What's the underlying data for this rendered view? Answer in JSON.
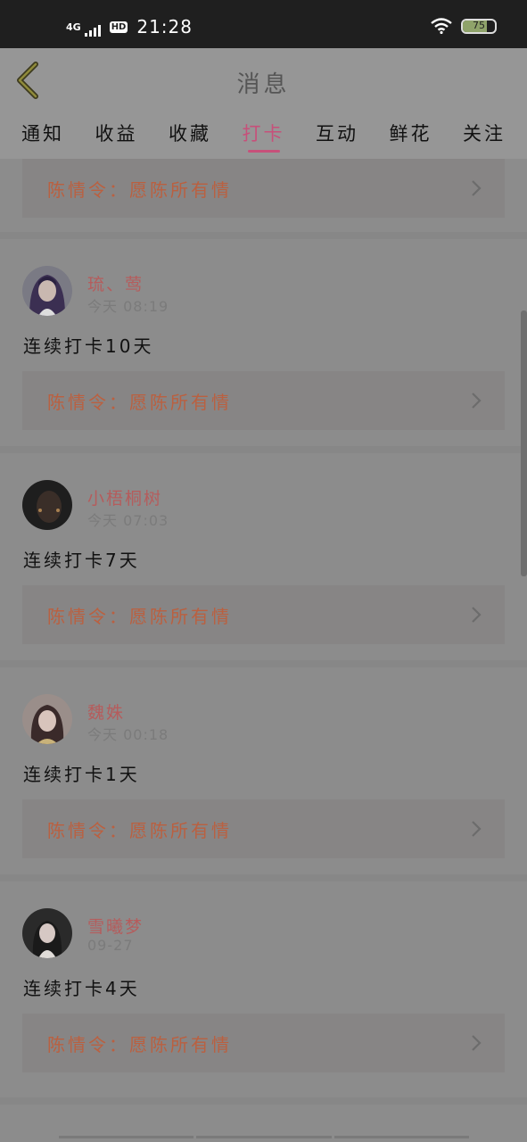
{
  "status_bar": {
    "network": "4G",
    "hd": "HD",
    "time": "21:28",
    "battery": "75",
    "battery_level": 0.75
  },
  "header": {
    "title": "消息"
  },
  "tabs": [
    {
      "label": "通知"
    },
    {
      "label": "收益"
    },
    {
      "label": "收藏"
    },
    {
      "label": "打卡",
      "active": true
    },
    {
      "label": "互动"
    },
    {
      "label": "鲜花"
    },
    {
      "label": "关注"
    }
  ],
  "items": [
    {
      "link": "陈情令：愿陈所有情"
    },
    {
      "name": "琉、莺",
      "time": "今天 08:19",
      "message": "连续打卡10天",
      "link": "陈情令：愿陈所有情"
    },
    {
      "name": "小梧桐树",
      "time": "今天 07:03",
      "message": "连续打卡7天",
      "link": "陈情令：愿陈所有情"
    },
    {
      "name": "魏姝",
      "time": "今天 00:18",
      "message": "连续打卡1天",
      "link": "陈情令：愿陈所有情"
    },
    {
      "name": "雪曦梦",
      "time": "09-27",
      "message": "连续打卡4天",
      "link": "陈情令：愿陈所有情"
    }
  ],
  "colors": {
    "accent": "#c7507a",
    "link_text": "#c35a35",
    "name_text": "#b55c5c"
  }
}
